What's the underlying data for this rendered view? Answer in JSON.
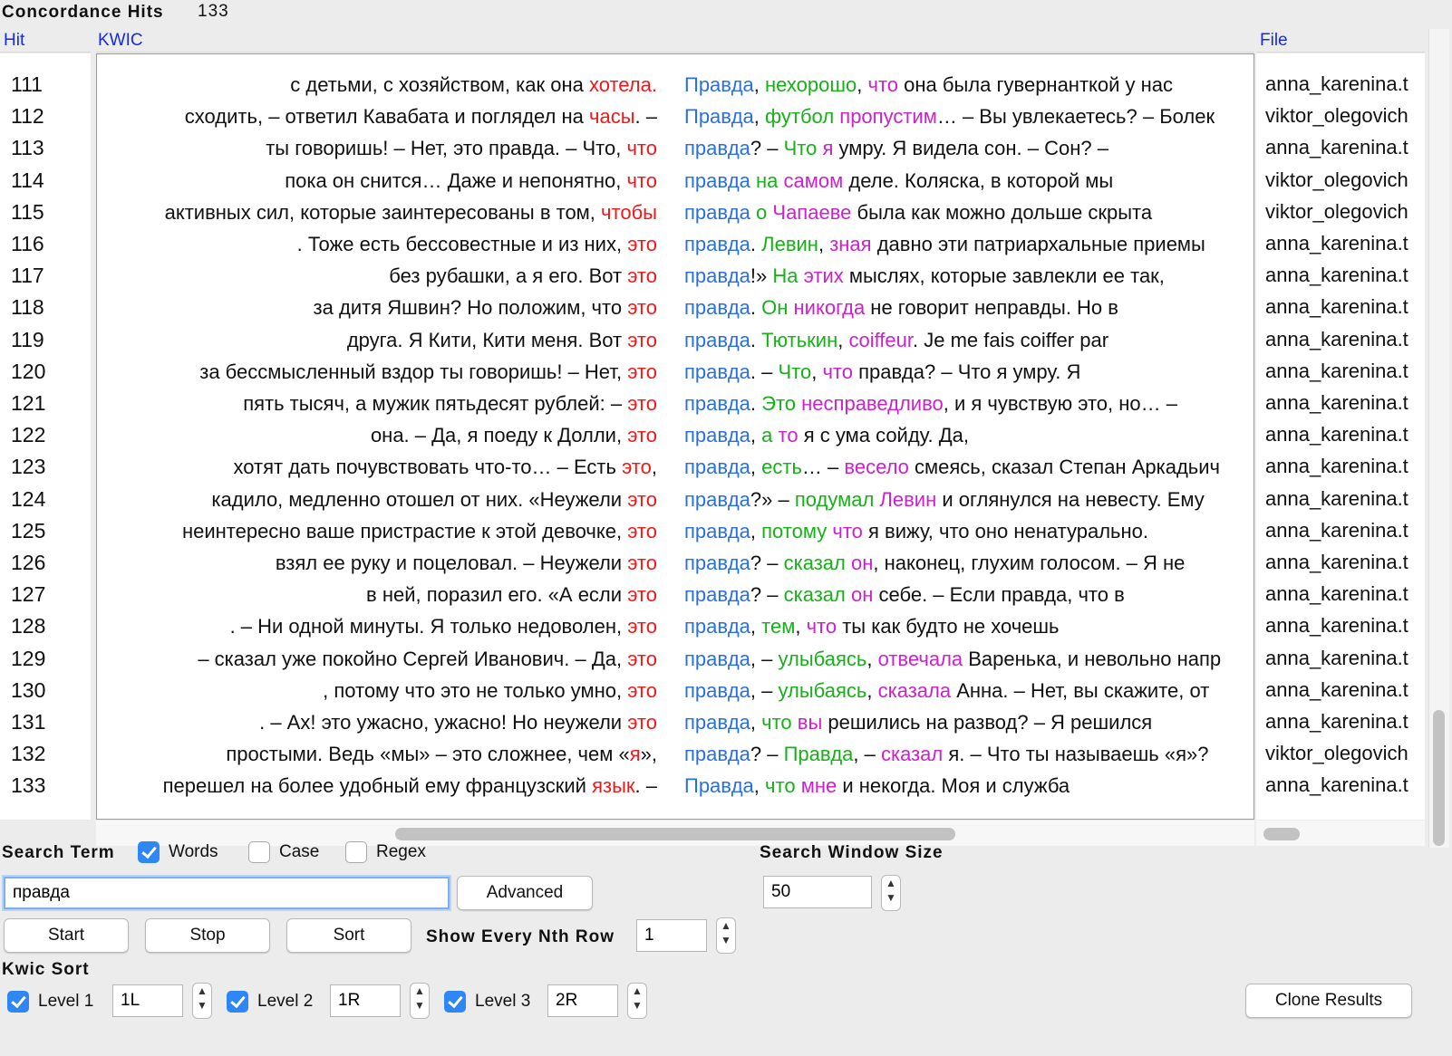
{
  "header": {
    "title": "Concordance Hits",
    "count": "133",
    "columns": {
      "hit": "Hit",
      "kwic": "KWIC",
      "file": "File"
    }
  },
  "rows": [
    {
      "num": "111",
      "left": [
        [
          "с детьми, с хозяйством, как она ",
          "k"
        ],
        [
          "хотела.",
          "red"
        ]
      ],
      "right": [
        [
          "Правда",
          "blue"
        ],
        [
          ", ",
          "k"
        ],
        [
          "нехорошо",
          "green"
        ],
        [
          ", ",
          "k"
        ],
        [
          "что",
          "mag"
        ],
        [
          " она была гувернанткой у нас",
          "k"
        ]
      ],
      "file": "anna_karenina.t"
    },
    {
      "num": "112",
      "left": [
        [
          "сходить, – ответил Кавабата и поглядел на ",
          "k"
        ],
        [
          "часы",
          "red"
        ],
        [
          ". –",
          "k"
        ]
      ],
      "right": [
        [
          "Правда",
          "blue"
        ],
        [
          ", ",
          "k"
        ],
        [
          "футбол",
          "green"
        ],
        [
          " ",
          "k"
        ],
        [
          "пропустим",
          "mag"
        ],
        [
          "… – Вы увлекаетесь? – Болек",
          "k"
        ]
      ],
      "file": "viktor_olegovich"
    },
    {
      "num": "113",
      "left": [
        [
          "ты говоришь! – Нет, это правда. – Что, ",
          "k"
        ],
        [
          "что",
          "red"
        ]
      ],
      "right": [
        [
          "правда",
          "blue"
        ],
        [
          "? – ",
          "k"
        ],
        [
          "Что",
          "green"
        ],
        [
          " ",
          "k"
        ],
        [
          "я",
          "mag"
        ],
        [
          " умру. Я видела сон. – Сон? –",
          "k"
        ]
      ],
      "file": "anna_karenina.t"
    },
    {
      "num": "114",
      "left": [
        [
          "пока он снится… Даже и непонятно, ",
          "k"
        ],
        [
          "что",
          "red"
        ]
      ],
      "right": [
        [
          "правда",
          "blue"
        ],
        [
          " ",
          "k"
        ],
        [
          "на",
          "green"
        ],
        [
          " ",
          "k"
        ],
        [
          "самом",
          "mag"
        ],
        [
          " деле. Коляска, в которой мы",
          "k"
        ]
      ],
      "file": "viktor_olegovich"
    },
    {
      "num": "115",
      "left": [
        [
          "активных сил, которые заинтересованы в том, ",
          "k"
        ],
        [
          "чтобы",
          "red"
        ]
      ],
      "right": [
        [
          "правда",
          "blue"
        ],
        [
          " ",
          "k"
        ],
        [
          "о",
          "green"
        ],
        [
          " ",
          "k"
        ],
        [
          "Чапаеве",
          "mag"
        ],
        [
          " была как можно дольше скрыта",
          "k"
        ]
      ],
      "file": "viktor_olegovich"
    },
    {
      "num": "116",
      "left": [
        [
          ". Тоже есть бессовестные и из них, ",
          "k"
        ],
        [
          "это",
          "red"
        ]
      ],
      "right": [
        [
          "правда",
          "blue"
        ],
        [
          ". ",
          "k"
        ],
        [
          "Левин",
          "green"
        ],
        [
          ", ",
          "k"
        ],
        [
          "зная",
          "mag"
        ],
        [
          " давно эти патриархальные приемы",
          "k"
        ]
      ],
      "file": "anna_karenina.t"
    },
    {
      "num": "117",
      "left": [
        [
          "без рубашки, а я его. Вот ",
          "k"
        ],
        [
          "это",
          "red"
        ]
      ],
      "right": [
        [
          "правда",
          "blue"
        ],
        [
          "!» ",
          "k"
        ],
        [
          "На",
          "green"
        ],
        [
          " ",
          "k"
        ],
        [
          "этих",
          "mag"
        ],
        [
          " мыслях, которые завлекли ее так,",
          "k"
        ]
      ],
      "file": "anna_karenina.t"
    },
    {
      "num": "118",
      "left": [
        [
          "за дитя Яшвин? Но положим, что ",
          "k"
        ],
        [
          "это",
          "red"
        ]
      ],
      "right": [
        [
          "правда",
          "blue"
        ],
        [
          ". ",
          "k"
        ],
        [
          "Он",
          "green"
        ],
        [
          " ",
          "k"
        ],
        [
          "никогда",
          "mag"
        ],
        [
          " не говорит неправды. Но в",
          "k"
        ]
      ],
      "file": "anna_karenina.t"
    },
    {
      "num": "119",
      "left": [
        [
          "друга. Я Кити, Кити меня. Вот ",
          "k"
        ],
        [
          "это",
          "red"
        ]
      ],
      "right": [
        [
          "правда",
          "blue"
        ],
        [
          ". ",
          "k"
        ],
        [
          "Тютькин",
          "green"
        ],
        [
          ", ",
          "k"
        ],
        [
          "coiffeur",
          "mag"
        ],
        [
          ". Je me fais coiffer par",
          "k"
        ]
      ],
      "file": "anna_karenina.t"
    },
    {
      "num": "120",
      "left": [
        [
          "за бессмысленный вздор ты говоришь! – Нет, ",
          "k"
        ],
        [
          "это",
          "red"
        ]
      ],
      "right": [
        [
          "правда",
          "blue"
        ],
        [
          ". – ",
          "k"
        ],
        [
          "Что",
          "green"
        ],
        [
          ", ",
          "k"
        ],
        [
          "что",
          "mag"
        ],
        [
          " правда? – Что я умру. Я",
          "k"
        ]
      ],
      "file": "anna_karenina.t"
    },
    {
      "num": "121",
      "left": [
        [
          "пять тысяч, а мужик пятьдесят рублей: – ",
          "k"
        ],
        [
          "это",
          "red"
        ]
      ],
      "right": [
        [
          "правда",
          "blue"
        ],
        [
          ". ",
          "k"
        ],
        [
          "Это",
          "green"
        ],
        [
          " ",
          "k"
        ],
        [
          "несправедливо",
          "mag"
        ],
        [
          ", и я чувствую это, но… –",
          "k"
        ]
      ],
      "file": "anna_karenina.t"
    },
    {
      "num": "122",
      "left": [
        [
          "она. – Да, я поеду к Долли, ",
          "k"
        ],
        [
          "это",
          "red"
        ]
      ],
      "right": [
        [
          "правда",
          "blue"
        ],
        [
          ", ",
          "k"
        ],
        [
          "а",
          "green"
        ],
        [
          " ",
          "k"
        ],
        [
          "то",
          "mag"
        ],
        [
          " я с ума сойду. Да,",
          "k"
        ]
      ],
      "file": "anna_karenina.t"
    },
    {
      "num": "123",
      "left": [
        [
          "хотят дать почувствовать что-то… – Есть ",
          "k"
        ],
        [
          "это",
          "red"
        ],
        [
          ",",
          "k"
        ]
      ],
      "right": [
        [
          "правда",
          "blue"
        ],
        [
          ", ",
          "k"
        ],
        [
          "есть",
          "green"
        ],
        [
          "… – ",
          "k"
        ],
        [
          "весело",
          "mag"
        ],
        [
          " смеясь, сказал Степан Аркадьич",
          "k"
        ]
      ],
      "file": "anna_karenina.t"
    },
    {
      "num": "124",
      "left": [
        [
          "кадило, медленно отошел от них. «Неужели ",
          "k"
        ],
        [
          "это",
          "red"
        ]
      ],
      "right": [
        [
          "правда",
          "blue"
        ],
        [
          "?» – ",
          "k"
        ],
        [
          "подумал",
          "green"
        ],
        [
          " ",
          "k"
        ],
        [
          "Левин",
          "mag"
        ],
        [
          " и оглянулся на невесту. Ему",
          "k"
        ]
      ],
      "file": "anna_karenina.t"
    },
    {
      "num": "125",
      "left": [
        [
          "неинтересно ваше пристрастие к этой девочке, ",
          "k"
        ],
        [
          "это",
          "red"
        ]
      ],
      "right": [
        [
          "правда",
          "blue"
        ],
        [
          ", ",
          "k"
        ],
        [
          "потому",
          "green"
        ],
        [
          " ",
          "k"
        ],
        [
          "что",
          "mag"
        ],
        [
          " я вижу, что оно ненатурально.",
          "k"
        ]
      ],
      "file": "anna_karenina.t"
    },
    {
      "num": "126",
      "left": [
        [
          "взял ее руку и поцеловал. – Неужели ",
          "k"
        ],
        [
          "это",
          "red"
        ]
      ],
      "right": [
        [
          "правда",
          "blue"
        ],
        [
          "? – ",
          "k"
        ],
        [
          "сказал",
          "green"
        ],
        [
          " ",
          "k"
        ],
        [
          "он",
          "mag"
        ],
        [
          ", наконец, глухим голосом. – Я не",
          "k"
        ]
      ],
      "file": "anna_karenina.t"
    },
    {
      "num": "127",
      "left": [
        [
          "в ней, поразил его. «А если ",
          "k"
        ],
        [
          "это",
          "red"
        ]
      ],
      "right": [
        [
          "правда",
          "blue"
        ],
        [
          "? – ",
          "k"
        ],
        [
          "сказал",
          "green"
        ],
        [
          " ",
          "k"
        ],
        [
          "он",
          "mag"
        ],
        [
          " себе. – Если правда, что в",
          "k"
        ]
      ],
      "file": "anna_karenina.t"
    },
    {
      "num": "128",
      "left": [
        [
          ". – Ни одной минуты. Я только недоволен, ",
          "k"
        ],
        [
          "это",
          "red"
        ]
      ],
      "right": [
        [
          "правда",
          "blue"
        ],
        [
          ", ",
          "k"
        ],
        [
          "тем",
          "green"
        ],
        [
          ", ",
          "k"
        ],
        [
          "что",
          "mag"
        ],
        [
          " ты как будто не хочешь",
          "k"
        ]
      ],
      "file": "anna_karenina.t"
    },
    {
      "num": "129",
      "left": [
        [
          "– сказал уже покойно Сергей Иванович. – Да, ",
          "k"
        ],
        [
          "это",
          "red"
        ]
      ],
      "right": [
        [
          "правда",
          "blue"
        ],
        [
          ", – ",
          "k"
        ],
        [
          "улыбаясь",
          "green"
        ],
        [
          ", ",
          "k"
        ],
        [
          "отвечала",
          "mag"
        ],
        [
          " Варенька, и невольно напр",
          "k"
        ]
      ],
      "file": "anna_karenina.t"
    },
    {
      "num": "130",
      "left": [
        [
          ", потому что это не только умно, ",
          "k"
        ],
        [
          "это",
          "red"
        ]
      ],
      "right": [
        [
          "правда",
          "blue"
        ],
        [
          ", – ",
          "k"
        ],
        [
          "улыбаясь",
          "green"
        ],
        [
          ", ",
          "k"
        ],
        [
          "сказала",
          "mag"
        ],
        [
          " Анна. – Нет, вы скажите, от",
          "k"
        ]
      ],
      "file": "anna_karenina.t"
    },
    {
      "num": "131",
      "left": [
        [
          ". – Ах! это ужасно, ужасно! Но неужели ",
          "k"
        ],
        [
          "это",
          "red"
        ]
      ],
      "right": [
        [
          "правда",
          "blue"
        ],
        [
          ", ",
          "k"
        ],
        [
          "что",
          "green"
        ],
        [
          " ",
          "k"
        ],
        [
          "вы",
          "mag"
        ],
        [
          " решились на развод? – Я решился",
          "k"
        ]
      ],
      "file": "anna_karenina.t"
    },
    {
      "num": "132",
      "left": [
        [
          "простыми. Ведь «мы» – это сложнее, чем «",
          "k"
        ],
        [
          "я",
          "red"
        ],
        [
          "»,",
          "k"
        ]
      ],
      "right": [
        [
          "правда",
          "blue"
        ],
        [
          "? – ",
          "k"
        ],
        [
          "Правда",
          "green"
        ],
        [
          ", – ",
          "k"
        ],
        [
          "сказал",
          "mag"
        ],
        [
          " я. – Что ты называешь «я»?",
          "k"
        ]
      ],
      "file": "viktor_olegovich"
    },
    {
      "num": "133",
      "left": [
        [
          "перешел на более удобный ему французский ",
          "k"
        ],
        [
          "язык",
          "red"
        ],
        [
          ". –",
          "k"
        ]
      ],
      "right": [
        [
          "Правда",
          "blue"
        ],
        [
          ", ",
          "k"
        ],
        [
          "что",
          "green"
        ],
        [
          " ",
          "k"
        ],
        [
          "мне",
          "mag"
        ],
        [
          " и некогда. Моя и служба",
          "k"
        ]
      ],
      "file": "anna_karenina.t"
    }
  ],
  "search": {
    "title": "Search Term",
    "words_label": "Words",
    "words_checked": true,
    "case_label": "Case",
    "case_checked": false,
    "regex_label": "Regex",
    "regex_checked": false,
    "term_value": "правда",
    "advanced_label": "Advanced",
    "start_label": "Start",
    "stop_label": "Stop",
    "sort_label": "Sort",
    "nth_label": "Show Every Nth Row",
    "nth_value": "1",
    "window_title": "Search Window Size",
    "window_value": "50"
  },
  "kwic_sort": {
    "title": "Kwic Sort",
    "levels": [
      {
        "label": "Level 1",
        "value": "1L",
        "checked": true
      },
      {
        "label": "Level 2",
        "value": "1R",
        "checked": true
      },
      {
        "label": "Level 3",
        "value": "2R",
        "checked": true
      }
    ],
    "clone_label": "Clone Results"
  },
  "colors": {
    "node": "#2a6fe0",
    "left_key": "#f01818",
    "right1": "#18b018",
    "right2": "#cc22cc",
    "header_link": "#1a2bd6",
    "checkbox": "#2f86f5"
  }
}
